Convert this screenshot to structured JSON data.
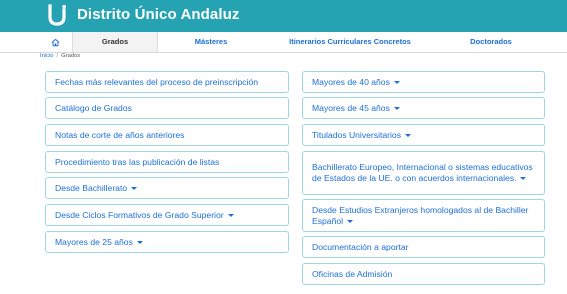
{
  "header": {
    "title": "Distrito Único Andaluz",
    "logo_icon": "du-logo-icon",
    "bg_color": "#25a3b3"
  },
  "nav": {
    "home_icon": "home-icon",
    "tabs": [
      {
        "label": "Grados",
        "active": true
      },
      {
        "label": "Másteres"
      },
      {
        "label": "Itinerarios Curriculares Concretos"
      },
      {
        "label": "Doctorados"
      }
    ]
  },
  "breadcrumb": {
    "home": "Inicio",
    "separator": "/",
    "current": "Grados"
  },
  "left_column": [
    {
      "label": "Fechas más relevantes del proceso de preinscripción"
    },
    {
      "label": "Catálogo de Grados"
    },
    {
      "label": "Notas de corte de años anteriores"
    },
    {
      "label": "Procedimiento tras las publicación de listas"
    },
    {
      "label": "Desde Bachillerato",
      "dropdown": true
    },
    {
      "label": "Desde Ciclos Formativos de Grado Superior",
      "dropdown": true
    },
    {
      "label": "Mayores de 25 años",
      "dropdown": true
    }
  ],
  "right_column": [
    {
      "label": "Mayores de 40 años",
      "dropdown": true
    },
    {
      "label": "Mayores de 45 años",
      "dropdown": true
    },
    {
      "label": "Titulados Universitarios",
      "dropdown": true
    },
    {
      "label": "Bachillerato Europeo, Internacional o sistemas educativos de Estados de la UE. o con acuerdos internacionales.",
      "dropdown": true
    },
    {
      "label": "Desde Estudios Extranjeros homologados al de Bachiller Español",
      "dropdown": true
    },
    {
      "label": "Documentación a aportar"
    },
    {
      "label": "Oficinas de Admisión"
    }
  ],
  "colors": {
    "link": "#1d6fd6",
    "button_border": "#9fd6e0"
  }
}
